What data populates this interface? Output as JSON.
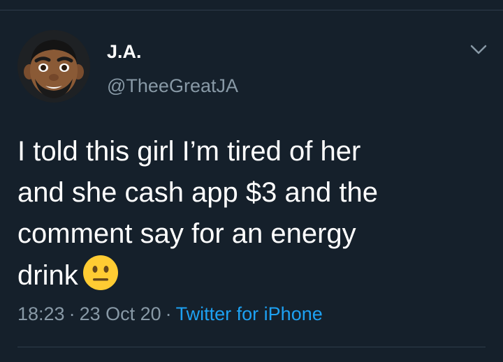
{
  "tweet": {
    "author": {
      "display_name": "J.A.",
      "handle": "@TheeGreatJA"
    },
    "text_lines": [
      "I told this girl I’m tired of her",
      "and she cash app $3 and the",
      "comment say for an energy",
      "drink"
    ],
    "emoji": "neutral-face-icon",
    "meta": {
      "time": "18:23",
      "separator": "·",
      "date": "23 Oct 20",
      "source": "Twitter for iPhone"
    }
  },
  "colors": {
    "background": "#15202b",
    "primary_text": "#ffffff",
    "secondary_text": "#8899a6",
    "link": "#1da1f2",
    "divider": "#2f3d4b"
  }
}
